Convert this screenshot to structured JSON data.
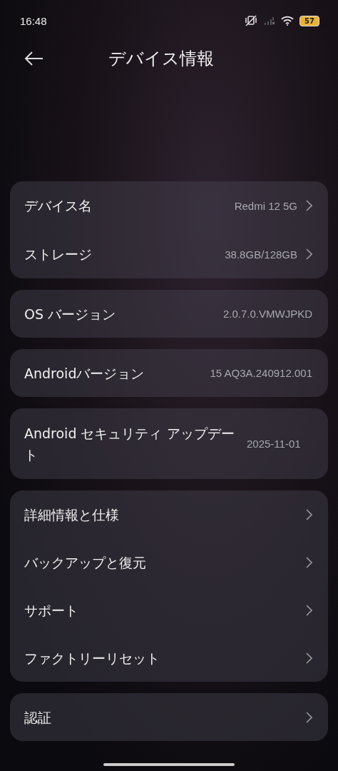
{
  "status_bar": {
    "time": "16:48",
    "battery": "57"
  },
  "header": {
    "title": "デバイス情報"
  },
  "groups": [
    {
      "rows": [
        {
          "label": "デバイス名",
          "value": "Redmi 12 5G",
          "chevron": true
        },
        {
          "label": "ストレージ",
          "value": "38.8GB/128GB",
          "chevron": true
        }
      ]
    },
    {
      "rows": [
        {
          "label": "OS バージョン",
          "value": "2.0.7.0.VMWJPKD",
          "chevron": false
        }
      ]
    },
    {
      "rows": [
        {
          "label": "Androidバージョン",
          "value": "15 AQ3A.240912.001",
          "chevron": false
        }
      ]
    },
    {
      "rows": [
        {
          "label": "Android セキュリティ アップデート",
          "value": "2025-11-01",
          "chevron": false
        }
      ]
    },
    {
      "rows": [
        {
          "label": "詳細情報と仕様",
          "chevron": true
        },
        {
          "label": "バックアップと復元",
          "chevron": true
        },
        {
          "label": "サポート",
          "chevron": true
        },
        {
          "label": "ファクトリーリセット",
          "chevron": true
        }
      ]
    },
    {
      "rows": [
        {
          "label": "認証",
          "chevron": true
        }
      ]
    }
  ]
}
